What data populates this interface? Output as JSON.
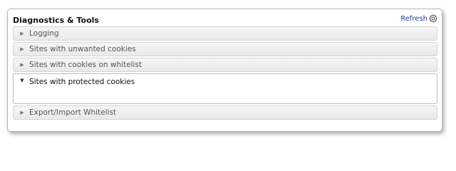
{
  "panel": {
    "title": "Diagnostics & Tools",
    "refresh_label": "Refresh"
  },
  "sections": [
    {
      "label": "Logging",
      "expanded": false
    },
    {
      "label": "Sites with unwanted cookies",
      "expanded": false
    },
    {
      "label": "Sites with cookies on whitelist",
      "expanded": false
    },
    {
      "label": "Sites with protected cookies",
      "expanded": true
    },
    {
      "label": "Export/Import Whitelist",
      "expanded": false
    }
  ],
  "icons": {
    "collapsed": "triangle-right-icon",
    "expanded": "triangle-down-icon",
    "refresh": "refresh-gear-icon"
  },
  "colors": {
    "link": "#1a3ca8",
    "header_bg": "#eeeeee"
  }
}
